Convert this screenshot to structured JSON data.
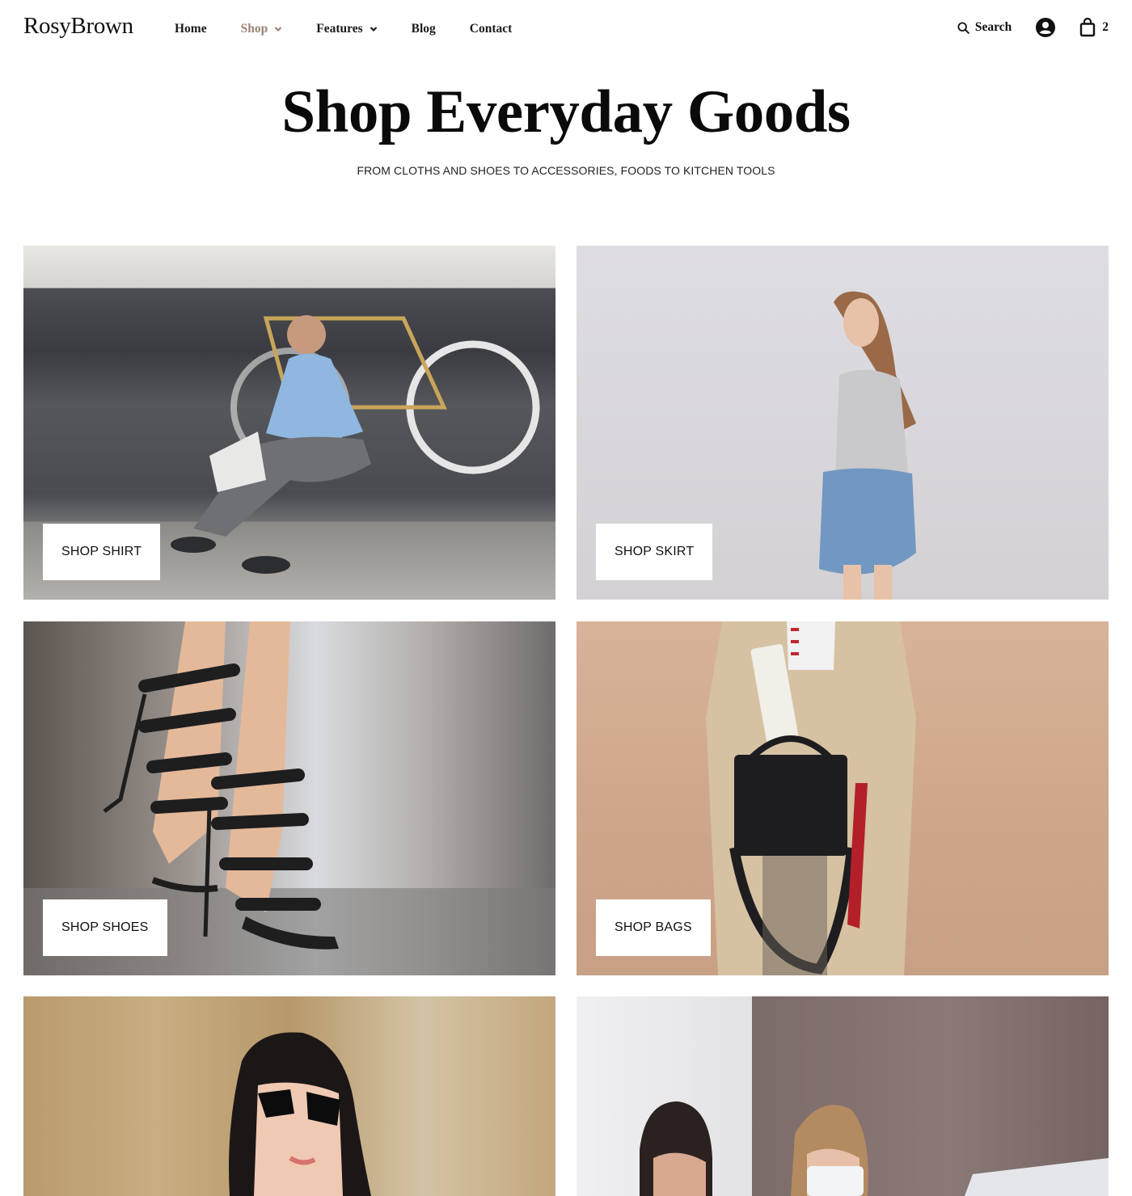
{
  "brand": {
    "name": "RosyBrown",
    "accent_color": "#9a8273"
  },
  "nav": {
    "items": [
      {
        "label": "Home",
        "has_dropdown": false,
        "active": false
      },
      {
        "label": "Shop",
        "has_dropdown": true,
        "active": true
      },
      {
        "label": "Features",
        "has_dropdown": true,
        "active": false
      },
      {
        "label": "Blog",
        "has_dropdown": false,
        "active": false
      },
      {
        "label": "Contact",
        "has_dropdown": false,
        "active": false
      }
    ]
  },
  "actions": {
    "search_label": "Search",
    "search_icon": "search-icon",
    "account_icon": "user-circle-icon",
    "cart_icon": "shopping-bag-icon",
    "cart_count": "2"
  },
  "hero": {
    "title": "Shop Everyday Goods",
    "subtitle": "FROM CLOTHS AND SHOES TO ACCESSORIES, FOODS TO KITCHEN TOOLS"
  },
  "categories": [
    {
      "label": "SHOP SHIRT",
      "image": "man sitting on stairs with bicycle"
    },
    {
      "label": "SHOP SKIRT",
      "image": "woman in denim skirt against wall"
    },
    {
      "label": "SHOP SHOES",
      "image": "black star-studded heeled sandals"
    },
    {
      "label": "SHOP BAGS",
      "image": "woman in trench coat holding black handbag"
    },
    {
      "label": "",
      "image": "woman wearing sunglasses"
    },
    {
      "label": "",
      "image": "two girls wearing face masks at laptop"
    }
  ]
}
